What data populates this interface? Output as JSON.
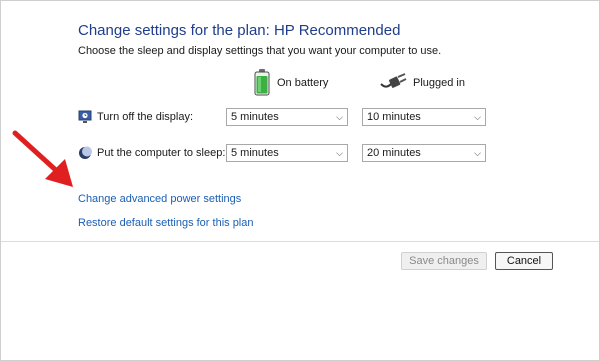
{
  "header": {
    "title": "Change settings for the plan: HP Recommended",
    "subtitle": "Choose the sleep and display settings that you want your computer to use."
  },
  "columns": {
    "on_battery": {
      "label": "On battery",
      "icon": "battery-icon"
    },
    "plugged_in": {
      "label": "Plugged in",
      "icon": "plug-icon"
    }
  },
  "rows": [
    {
      "label": "Turn off the display:",
      "icon": "display-icon",
      "battery": "5 minutes",
      "plugged": "10 minutes"
    },
    {
      "label": "Put the computer to sleep:",
      "icon": "sleep-moon-icon",
      "battery": "5 minutes",
      "plugged": "20 minutes"
    }
  ],
  "links": {
    "advanced": "Change advanced power settings",
    "restore": "Restore default settings for this plan"
  },
  "buttons": {
    "save": "Save changes",
    "cancel": "Cancel"
  },
  "colors": {
    "title": "#1f3d8c",
    "link": "#1b5fb4",
    "annotation_arrow": "#e02020",
    "battery_green": "#3cb043"
  }
}
